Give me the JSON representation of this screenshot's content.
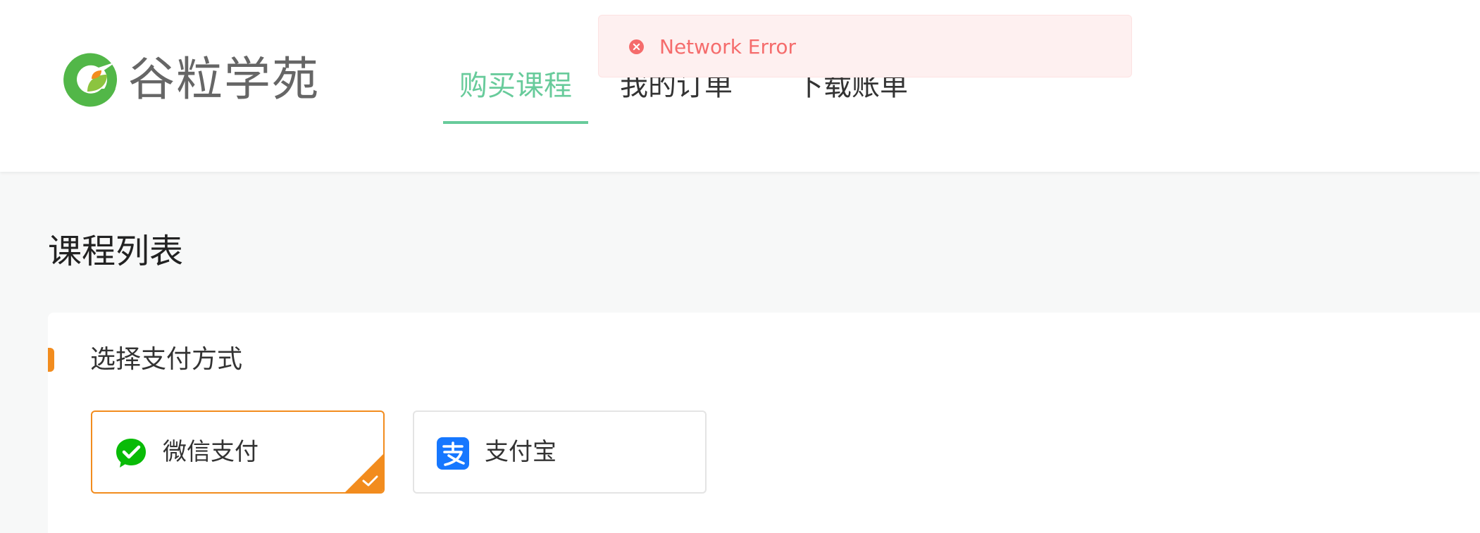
{
  "brand": {
    "name": "谷粒学苑",
    "logo_icon": "guli-logo-icon",
    "accent": "#68cb9b",
    "logo_orange": "#f28c1e"
  },
  "nav": {
    "items": [
      {
        "label": "购买课程",
        "active": true
      },
      {
        "label": "我的订单",
        "active": false
      },
      {
        "label": "下载账单",
        "active": false
      }
    ]
  },
  "toast": {
    "type": "error",
    "icon": "error-circle-icon",
    "message": "Network Error",
    "color": "#f56c6c",
    "background": "#fef0f0"
  },
  "page": {
    "title": "课程列表"
  },
  "payment": {
    "section_title": "选择支付方式",
    "selected_color": "#f28c1e",
    "options": [
      {
        "label": "微信支付",
        "icon": "wechat-pay-icon",
        "selected": true,
        "icon_color": "#09bb07"
      },
      {
        "label": "支付宝",
        "icon": "alipay-icon",
        "selected": false,
        "icon_color": "#1677ff"
      }
    ]
  }
}
